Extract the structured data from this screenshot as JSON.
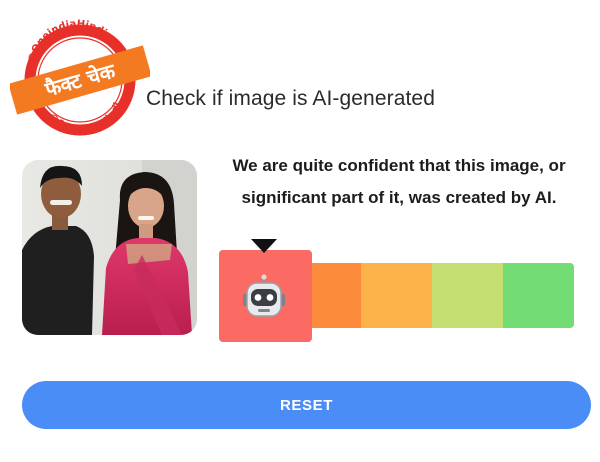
{
  "stamp": {
    "handle_top": "@OneindiaHindi",
    "handle_bottom": "@OneindiaHindi",
    "banner_text": "फैक्ट चेक",
    "ring_color": "#e8302a",
    "banner_color": "#f47a22"
  },
  "header": {
    "title": "Check if image is AI-generated"
  },
  "result": {
    "message": "We are quite confident that this image, or significant part of it, was created by AI.",
    "level": 1,
    "level_count": 5,
    "indicator_icon": "robot-icon"
  },
  "scale": {
    "colors": [
      "#fb6b63",
      "#fd8b3c",
      "#fdb24a",
      "#c6df72",
      "#74dc74"
    ]
  },
  "actions": {
    "reset_label": "RESET",
    "reset_color": "#4a8df7"
  }
}
